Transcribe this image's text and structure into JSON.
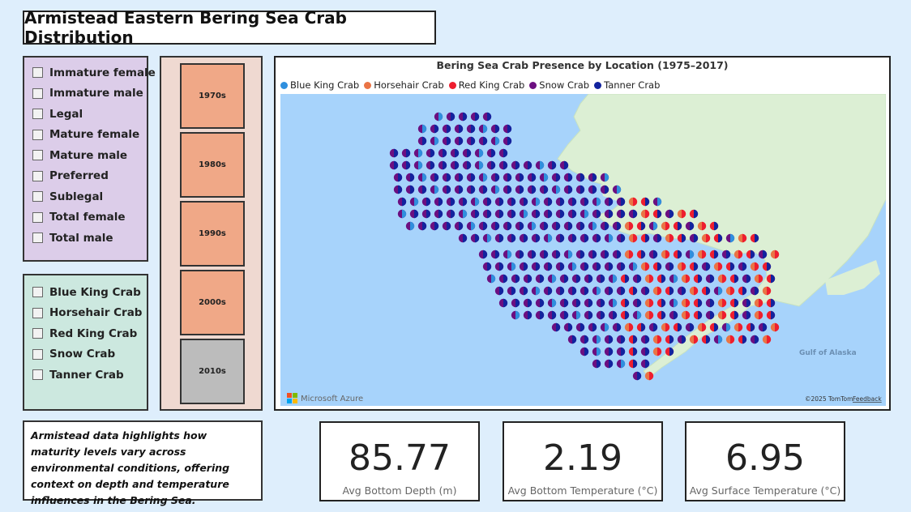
{
  "header": {
    "title": "Armistead Eastern Bering Sea Crab Distribution"
  },
  "maturity_filter": {
    "items": [
      "Immature female",
      "Immature male",
      "Legal",
      "Mature female",
      "Mature male",
      "Preferred",
      "Sublegal",
      "Total female",
      "Total male"
    ]
  },
  "species_filter": {
    "items": [
      "Blue King Crab",
      "Horsehair Crab",
      "Red King Crab",
      "Snow Crab",
      "Tanner Crab"
    ]
  },
  "decade_filter": {
    "items": [
      {
        "label": "1970s",
        "color": "#f0a887"
      },
      {
        "label": "1980s",
        "color": "#f0a887"
      },
      {
        "label": "1990s",
        "color": "#f0a887"
      },
      {
        "label": "2000s",
        "color": "#f0a887"
      },
      {
        "label": "2010s",
        "color": "#bcbcbc"
      }
    ]
  },
  "note": {
    "text": "Armistead data highlights how maturity levels vary across environmental conditions, offering context on depth and temperature influences in the Bering Sea."
  },
  "map": {
    "title": "Bering Sea Crab Presence by Location (1975–2017)",
    "legend": [
      {
        "name": "Blue King Crab",
        "color": "#2f8fde"
      },
      {
        "name": "Horsehair Crab",
        "color": "#ea7445"
      },
      {
        "name": "Red King Crab",
        "color": "#ee1e2f"
      },
      {
        "name": "Snow Crab",
        "color": "#6c0f80"
      },
      {
        "name": "Tanner Crab",
        "color": "#12239e"
      }
    ],
    "place_label": "Gulf of Alaska",
    "provider": "Microsoft Azure",
    "copyright": "©2025 TomTom",
    "feedback": "Feedback",
    "water_color": "#a7d3fb",
    "land_color": "#dcefd4"
  },
  "kpis": [
    {
      "value": "85.77",
      "label": "Avg Bottom Depth (m)"
    },
    {
      "value": "2.19",
      "label": "Avg Bottom Temperature (°C)"
    },
    {
      "value": "6.95",
      "label": "Avg Surface Temperature (°C)"
    }
  ]
}
